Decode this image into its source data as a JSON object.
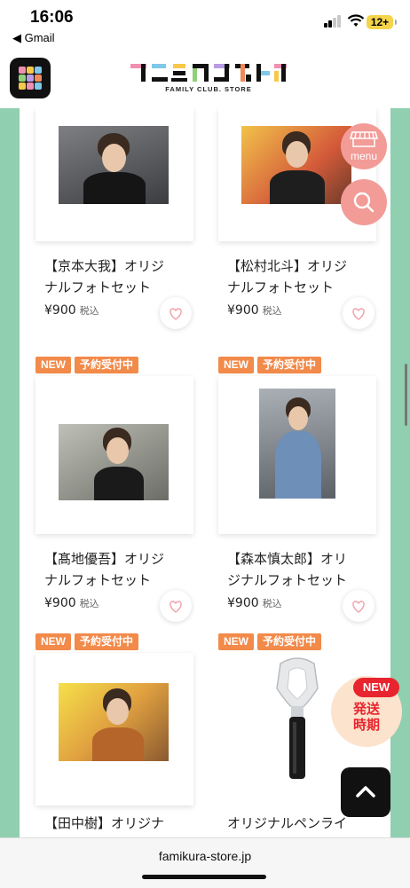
{
  "status": {
    "time": "16:06",
    "back_app": "◀ Gmail",
    "battery": "12+"
  },
  "header": {
    "logo_text": "ファミクラストア",
    "logo_sub": "FAMILY CLUB. STORE"
  },
  "float": {
    "menu_label": "menu"
  },
  "new_shipping": {
    "badge": "NEW",
    "line1": "発送",
    "line2": "時期"
  },
  "products": [
    {
      "title_line1": "【京本大我】オリジ",
      "title_line2": "ナルフォトセット",
      "price": "¥900",
      "tax": "税込",
      "badges": []
    },
    {
      "title_line1": "【松村北斗】オリジ",
      "title_line2": "ナルフォトセット",
      "price": "¥900",
      "tax": "税込",
      "badges": []
    },
    {
      "title_line1": "【髙地優吾】オリジ",
      "title_line2": "ナルフォトセット",
      "price": "¥900",
      "tax": "税込",
      "badges": [
        "NEW",
        "予約受付中"
      ]
    },
    {
      "title_line1": "【森本慎太郎】オリ",
      "title_line2": "ジナルフォトセット",
      "price": "¥900",
      "tax": "税込",
      "badges": [
        "NEW",
        "予約受付中"
      ]
    },
    {
      "title_line1": "【田中樹】オリジナ",
      "title_line2": "",
      "price": "",
      "tax": "",
      "badges": [
        "NEW",
        "予約受付中"
      ]
    },
    {
      "title_line1": "オリジナルペンライ",
      "title_line2": "",
      "price": "",
      "tax": "",
      "badges": [
        "NEW",
        "予約受付中"
      ]
    }
  ],
  "urlbar": {
    "url": "famikura-store.jp"
  }
}
